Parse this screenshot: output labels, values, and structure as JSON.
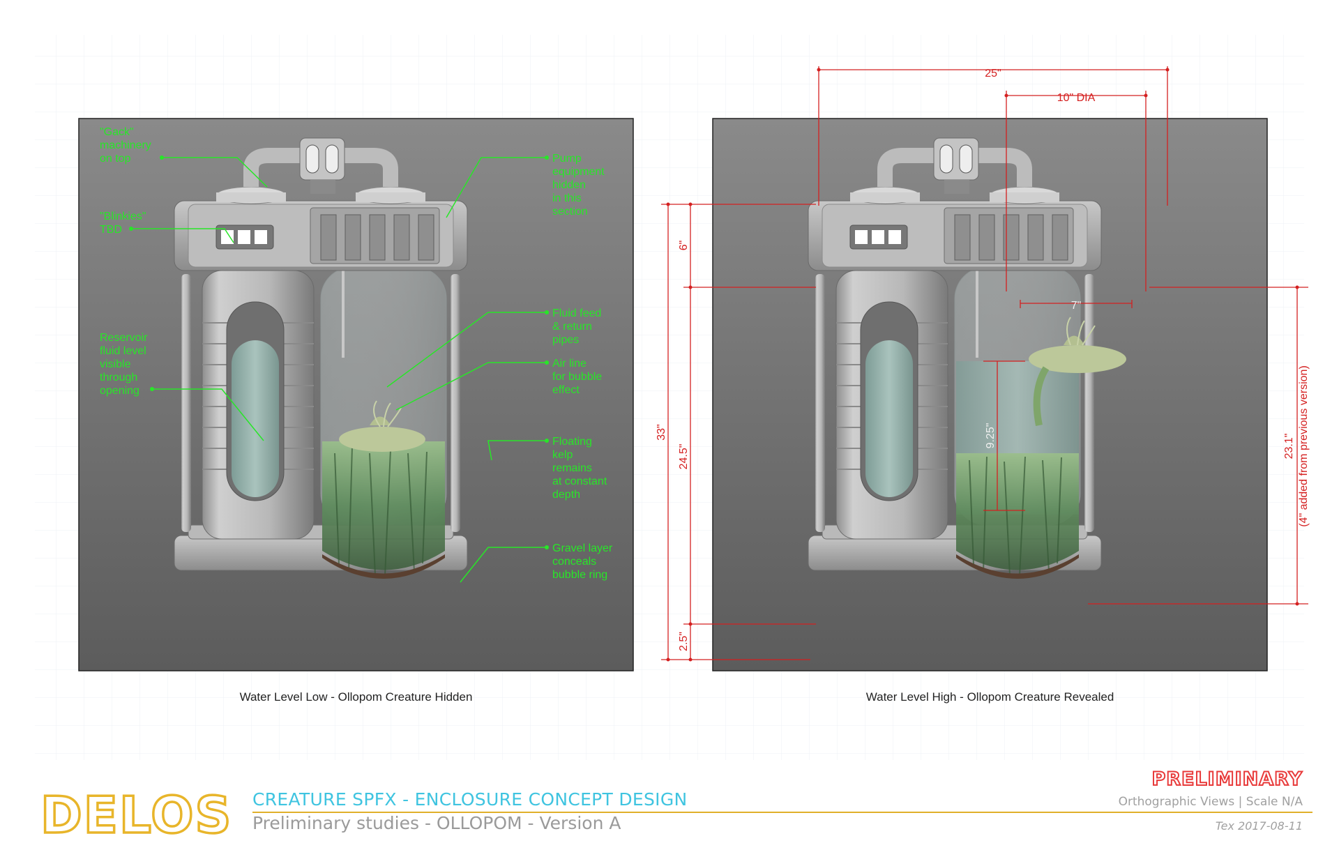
{
  "panels": [
    {
      "caption": "Water Level Low - Ollopom Creature Hidden"
    },
    {
      "caption": "Water Level High - Ollopom Creature Revealed"
    }
  ],
  "callouts": [
    {
      "text": "\"Gack\"\nmachinery\non top"
    },
    {
      "text": "\"Blinkies\"\nTBD"
    },
    {
      "text": "Reservoir\nfluid level\nvisible\nthrough\nopening"
    },
    {
      "text": "Pump\nequipment\nhidden\nin this\nsection"
    },
    {
      "text": "Fluid feed\n& return\npipes"
    },
    {
      "text": "Air line\nfor bubble\neffect"
    },
    {
      "text": "Floating\nkelp\nremains\nat constant\ndepth"
    },
    {
      "text": "Gravel layer\nconceals\nbubble ring"
    }
  ],
  "dimensions": {
    "overall_width": "25\"",
    "tank_diameter": "10\" DIA",
    "inner_width": "7\"",
    "overall_height": "33\"",
    "top_height": "6\"",
    "middle_height": "24.5\"",
    "base_height": "2.5\"",
    "water_depth": "9.25\"",
    "tank_height": "23.1\"",
    "tank_height_note": "(4\" added from previous version)"
  },
  "title_block": {
    "logo": "DELOS",
    "title": "CREATURE SPFX - ENCLOSURE CONCEPT DESIGN",
    "subtitle": "Preliminary studies - OLLOPOM - Version A",
    "status": "PRELIMINARY",
    "views": "Orthographic Views | Scale N/A",
    "author_date": "Tex 2017-08-11"
  },
  "colors": {
    "callout": "#28e628",
    "dimension": "#d42020",
    "title": "#3fc4e0",
    "logo": "#e8b52a"
  }
}
